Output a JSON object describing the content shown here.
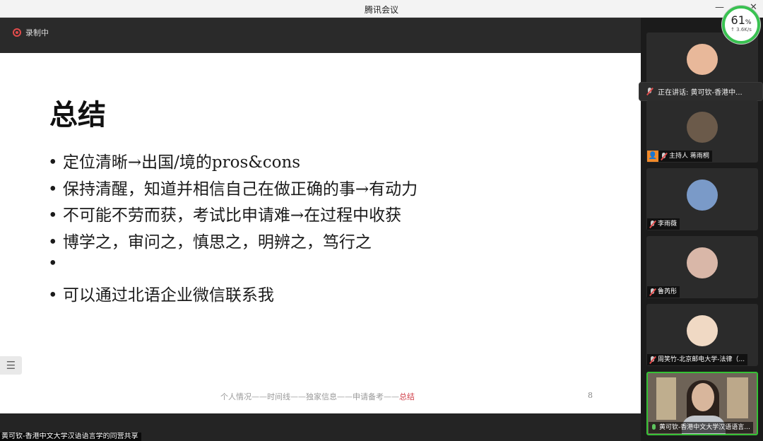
{
  "window": {
    "title": "腾讯会议",
    "min_symbol": "—",
    "close_symbol": "✕"
  },
  "recording": {
    "label": "录制中"
  },
  "slide": {
    "title": "总结",
    "bullets": [
      "定位清晰→出国/境的pros&cons",
      "保持清醒，知道并相信自己在做正确的事→有动力",
      "不可能不劳而获，考试比申请难→在过程中收获",
      "博学之，审问之，慎思之，明辨之，笃行之"
    ],
    "bullet_last": "可以通过北语企业微信联系我",
    "footer_nav": {
      "prefix": "个人情况——时间线——独家信息——申请备考——",
      "active": "总结"
    },
    "page_number": "8"
  },
  "side_button_icon": "list-icon",
  "bottom_name": "黄可钦-香港中文大学汉语语言学的同营共享",
  "speaking": {
    "label": "正在讲话: 黄可钦-香港中..."
  },
  "participants": [
    {
      "name": "",
      "host": false,
      "avatar_color": "#e8b89a"
    },
    {
      "name": "主持人 蒋雨桐",
      "host": true,
      "host_icon": "👤",
      "avatar_color": "#6b5a4a"
    },
    {
      "name": "李雨薇",
      "host": false,
      "avatar_color": "#7a9ac8"
    },
    {
      "name": "鲁芮彤",
      "host": false,
      "avatar_color": "#d9b7a8"
    },
    {
      "name": "周笑竹-北京邮电大学-法律（...",
      "host": false,
      "avatar_color": "#f0d9c4"
    }
  ],
  "active_video": {
    "name": "黄可钦-香港中文大学汉语语言..."
  },
  "network": {
    "percent": "61",
    "unit": "%",
    "speed": "↑ 3.6K/s"
  }
}
